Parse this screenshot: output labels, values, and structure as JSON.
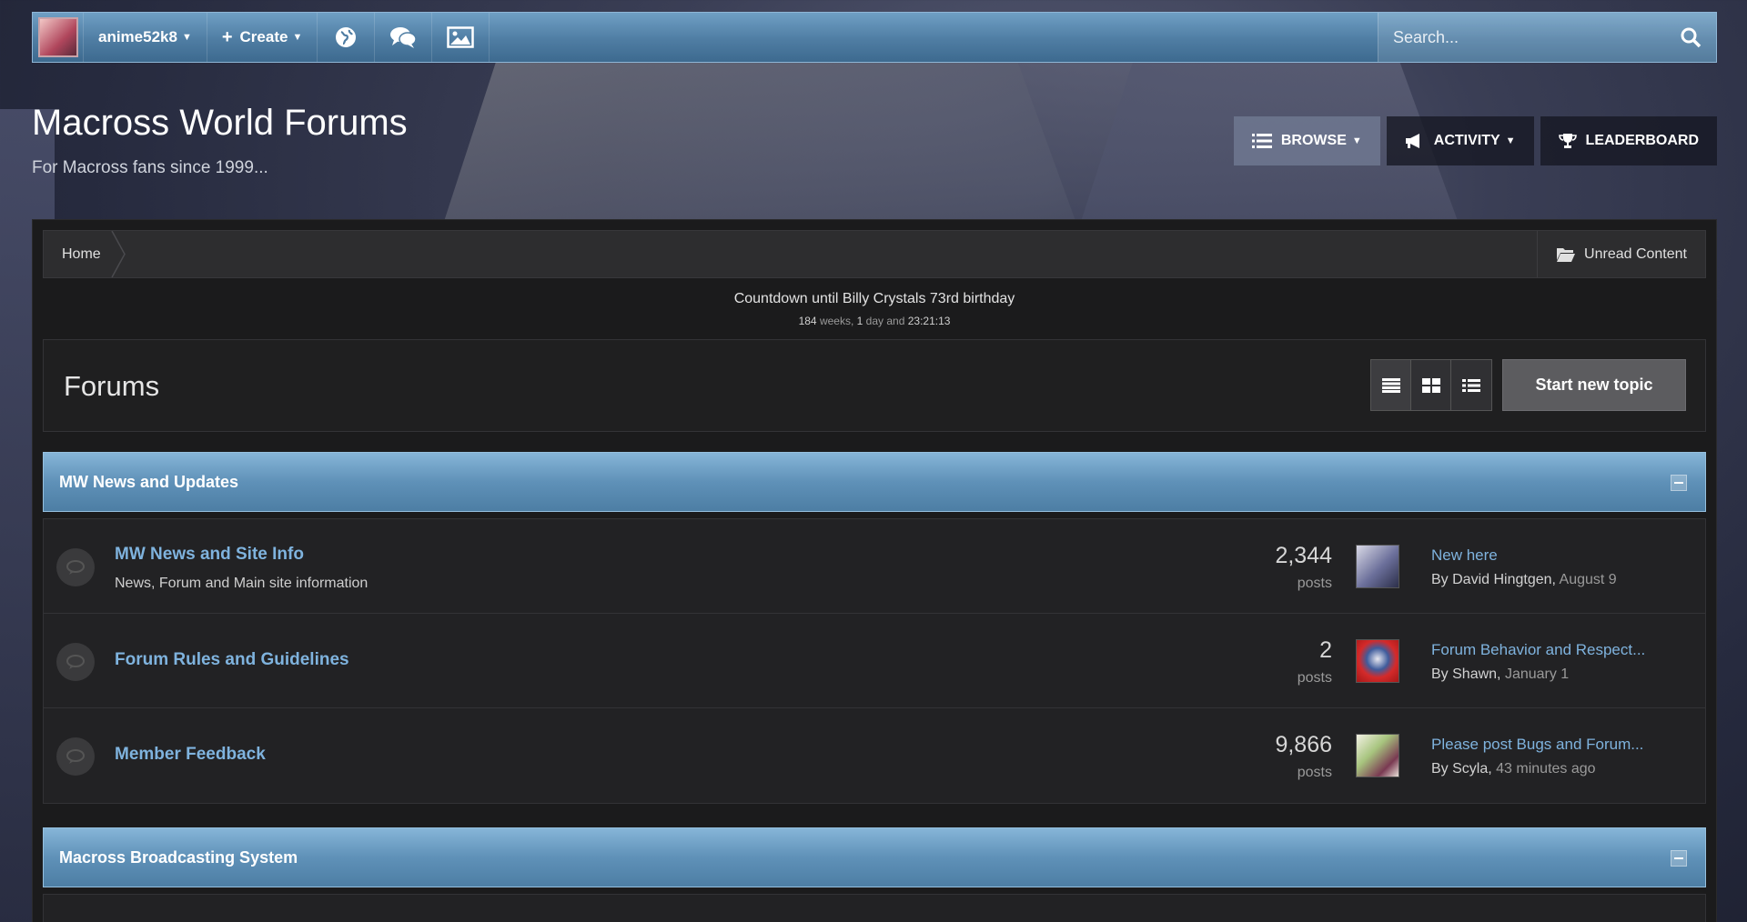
{
  "userbar": {
    "username": "anime52k8",
    "create_label": "Create",
    "search_placeholder": "Search..."
  },
  "header": {
    "title": "Macross World Forums",
    "subtitle": "For Macross fans since 1999...",
    "nav": [
      {
        "label": "BROWSE",
        "icon": "list-icon"
      },
      {
        "label": "ACTIVITY",
        "icon": "megaphone-icon"
      },
      {
        "label": "LEADERBOARD",
        "icon": "trophy-icon"
      }
    ]
  },
  "breadcrumb": {
    "home": "Home",
    "unread": "Unread Content"
  },
  "countdown": {
    "title": "Countdown until Billy Crystals 73rd birthday",
    "weeks": "184",
    "weeks_label": "weeks,",
    "days": "1",
    "days_label": "day and",
    "time": "23:21:13"
  },
  "forums": {
    "title": "Forums",
    "start_topic": "Start new topic"
  },
  "categories": [
    {
      "name": "MW News and Updates",
      "forums": [
        {
          "name": "MW News and Site Info",
          "description": "News, Forum and Main site information",
          "count": "2,344",
          "count_label": "posts",
          "last_title": "New here",
          "last_by": "By David Hingtgen,",
          "last_when": "August 9"
        },
        {
          "name": "Forum Rules and Guidelines",
          "description": "",
          "count": "2",
          "count_label": "posts",
          "last_title": "Forum Behavior and Respect...",
          "last_by": "By Shawn,",
          "last_when": "January 1"
        },
        {
          "name": "Member Feedback",
          "description": "",
          "count": "9,866",
          "count_label": "posts",
          "last_title": "Please post Bugs and Forum...",
          "last_by": "By Scyla,",
          "last_when": "43 minutes ago"
        }
      ]
    },
    {
      "name": "Macross Broadcasting System",
      "forums": []
    }
  ],
  "colors": {
    "accent": "#7fb3de",
    "category_bar": "#5f91b8"
  }
}
